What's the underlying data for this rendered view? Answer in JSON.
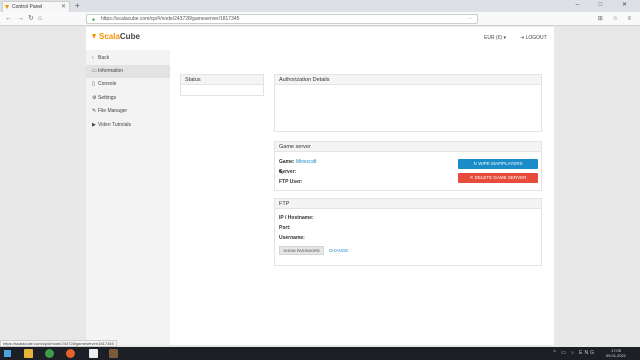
{
  "browser": {
    "tab_title": "Control Panel",
    "new_tab": "+",
    "url": "https://scalacube.com/cp/#/node/243728/gameserver/1817345",
    "window_controls": "– □ ✕",
    "status_url": "https://scalacube.com/cp/#/node/243728/gameserver/1817345"
  },
  "header": {
    "logo_part1": "Scala",
    "logo_part2": "Cube",
    "currency": "EUR (€) ▾",
    "logout": "LOGOUT"
  },
  "sidebar": {
    "items": [
      {
        "icon": "‹",
        "label": "Back"
      },
      {
        "icon": "▭",
        "label": "Information"
      },
      {
        "icon": "▯",
        "label": "Console"
      },
      {
        "icon": "⚙",
        "label": "Settings"
      },
      {
        "icon": "✎",
        "label": "File Manager"
      },
      {
        "icon": "▶",
        "label": "Video Tutorials"
      }
    ]
  },
  "status_panel": {
    "title": "Status"
  },
  "auth_panel": {
    "title": "Authorization Details"
  },
  "game_server": {
    "title": "Game server",
    "game_label": "Game:",
    "game_value": "Minecraft",
    "server_label": "Server:",
    "ftp_user_label": "FTP User:",
    "wipe_button": "WIPE MAP/PLAYERS",
    "delete_button": "DELETE GAME SERVER"
  },
  "ftp": {
    "title": "FTP",
    "ip_label": "IP / Hostname:",
    "port_label": "Port:",
    "username_label": "Username:",
    "show_password": "SHOW PASSWORD",
    "change": "CHANGE"
  },
  "taskbar": {
    "lang": "ENG",
    "time": "17:05",
    "date": "09.01.2021"
  },
  "colors": {
    "accent_orange": "#f39200",
    "link_blue": "#1a8cc8",
    "danger_red": "#e64b3c"
  }
}
